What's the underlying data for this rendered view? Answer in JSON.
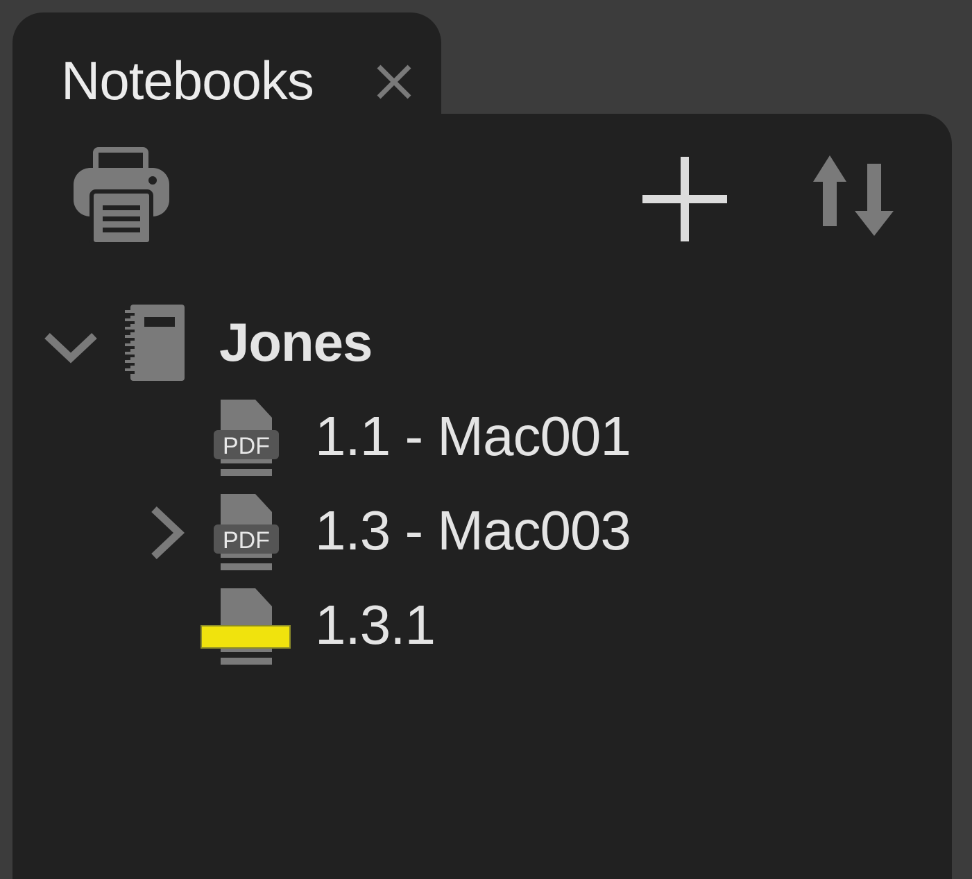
{
  "tab": {
    "title": "Notebooks",
    "close_icon": "close-icon"
  },
  "toolbar": {
    "print_icon": "print-icon",
    "add_icon": "plus-icon",
    "sort_icon": "sort-icon"
  },
  "tree": {
    "notebook": {
      "label": "Jones",
      "expanded": true,
      "icon": "notebook-icon",
      "children": [
        {
          "label": "1.1 - Mac001",
          "icon": "pdf-icon",
          "expandable": false
        },
        {
          "label": "1.3 - Mac003",
          "icon": "pdf-icon",
          "expandable": true,
          "expanded": false
        },
        {
          "label": "1.3.1",
          "icon": "highlighted-page-icon",
          "expandable": false
        }
      ]
    }
  },
  "colors": {
    "background": "#3c3c3c",
    "panel": "#212121",
    "icon_gray": "#7a7a7a",
    "text": "#e4e4e4",
    "highlight": "#f0e30d"
  }
}
